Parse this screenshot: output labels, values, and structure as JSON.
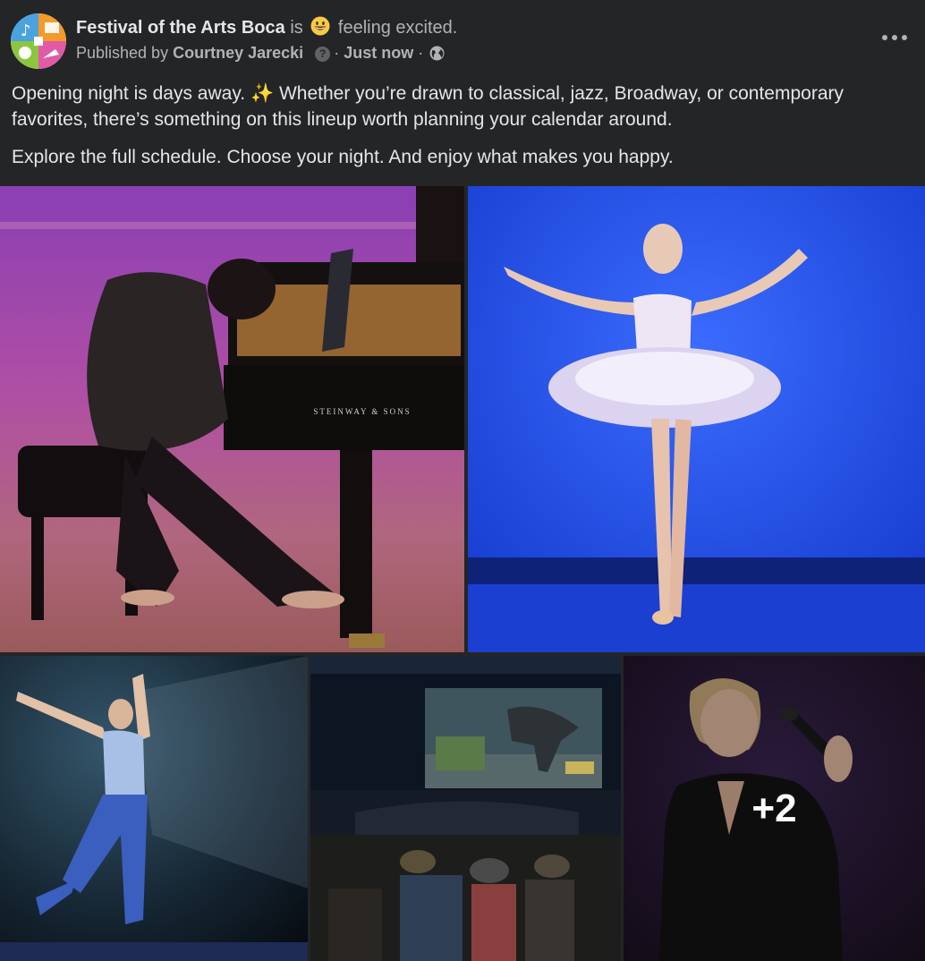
{
  "post": {
    "page_name": "Festival of the Arts Boca",
    "is_word": "is",
    "feeling_text": "feeling excited.",
    "published_by_label": "Published by",
    "publisher_name": "Courtney Jarecki",
    "separator": "·",
    "timestamp": "Just now",
    "paragraphs": [
      "Opening night is days away.",
      "Whether you’re drawn to classical, jazz, Broadway, or contemporary favorites, there’s something on this lineup worth planning your calendar around.",
      "Explore the full schedule. Choose your night. And enjoy what makes you happy."
    ],
    "sparkle_emoji": "✨",
    "piano_brand": "STEINWAY & SONS",
    "more_photos_label": "+2"
  },
  "icons": [
    "festival-logo-avatar",
    "grinning-face-emoji",
    "help-icon",
    "globe-icon",
    "more-options-icon",
    "sparkles-emoji"
  ],
  "colors": {
    "background": "#242526",
    "primary_text": "#e4e6eb",
    "secondary_text": "#b0b3b8"
  }
}
